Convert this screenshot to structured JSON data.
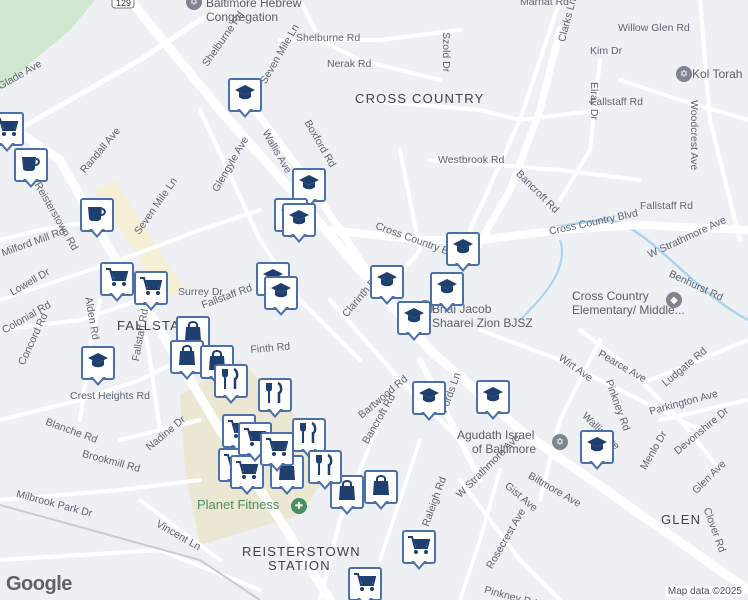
{
  "map": {
    "area_labels": [
      {
        "text": "CROSS COUNTRY"
      },
      {
        "text": "FALLSTAFF"
      },
      {
        "text": "GLEN"
      },
      {
        "text": "REISTERSTOWN"
      },
      {
        "text": "STATION"
      }
    ],
    "poi_labels": [
      {
        "text": "Baltimore Hebrew"
      },
      {
        "text": "Congregation"
      },
      {
        "text": "Kol Torah"
      },
      {
        "text": "Cross Country"
      },
      {
        "text": "Elementary/ Middle..."
      },
      {
        "text": "Bnai Jacob"
      },
      {
        "text": "Shaarei Zion BJSZ"
      },
      {
        "text": "Agudath Israel"
      },
      {
        "text": "of Baltimore"
      },
      {
        "text": "Planet Fitness"
      }
    ],
    "street_labels": [
      "Marnat Rd",
      "Willow Glen Rd",
      "Shelburne Rd",
      "Kim Dr",
      "Nerak Rd",
      "Szold Dr",
      "Elray Dr",
      "Clarks Ln",
      "Shelburne Rd",
      "Seven Mile Ln",
      "Boxford Rd",
      "Fallstaff Rd",
      "Wallis Ave",
      "Fallstaff Rd",
      "Westbrook Rd",
      "Bancroft Rd",
      "Woodcrest Ave",
      "Glade Ave",
      "Randall Ave",
      "Reisterstown Rd",
      "Glengyle Ave",
      "Seven Mile Ln",
      "Cross Country Blvd",
      "Cross Country Blvd",
      "W Strathmore Ave",
      "Benhurst Rd",
      "Milford Mill Rd",
      "Lowell Dr",
      "Surrey Dr",
      "Fallstaff Rd",
      "Clarinth Rd",
      "Alden Rd",
      "Colonial Rd",
      "Concord Rd",
      "Fallstaff Rd",
      "Crest Heights Rd",
      "Wirt Ave",
      "Pearce Ave",
      "Pinkney Rd",
      "Ludgate Rd",
      "Wallis Ave",
      "Parkington Ave",
      "Blanche Rd",
      "Nadine Dr",
      "Bartwood Rd",
      "Bancroft Rd",
      "Fords Ln",
      "Menlo Dr",
      "Devonshire Dr",
      "Glen Ave",
      "Brookmill Rd",
      "Biltmore Ave",
      "Clover Rd",
      "Gist Ave",
      "W Strathmore Ave",
      "Milbrook Park Dr",
      "Vincent Ln",
      "Rosecrest Ave",
      "Pinkney Rd",
      "Raleigh Rd",
      "Finth Rd"
    ],
    "route_shield": "129",
    "markers": [
      {
        "type": "school"
      },
      {
        "type": "school"
      },
      {
        "type": "school"
      },
      {
        "type": "school"
      },
      {
        "type": "school"
      },
      {
        "type": "school"
      },
      {
        "type": "school"
      },
      {
        "type": "school"
      },
      {
        "type": "school"
      },
      {
        "type": "school"
      },
      {
        "type": "school"
      },
      {
        "type": "school"
      },
      {
        "type": "school"
      },
      {
        "type": "school"
      },
      {
        "type": "coffee"
      },
      {
        "type": "coffee"
      },
      {
        "type": "shopping-cart"
      },
      {
        "type": "shopping-cart"
      },
      {
        "type": "shopping-cart"
      },
      {
        "type": "shopping-cart"
      },
      {
        "type": "shopping-cart"
      },
      {
        "type": "shopping-cart"
      },
      {
        "type": "shopping-cart"
      },
      {
        "type": "shopping-cart"
      },
      {
        "type": "shopping-bag"
      },
      {
        "type": "shopping-bag"
      },
      {
        "type": "shopping-bag"
      },
      {
        "type": "shopping-bag"
      },
      {
        "type": "shopping-bag"
      },
      {
        "type": "shopping-bag"
      },
      {
        "type": "restaurant"
      },
      {
        "type": "restaurant"
      },
      {
        "type": "restaurant"
      },
      {
        "type": "restaurant"
      },
      {
        "type": "shopping-cart"
      },
      {
        "type": "shopping-cart"
      }
    ],
    "attribution": "Map data ©2025",
    "logo": "Google"
  }
}
